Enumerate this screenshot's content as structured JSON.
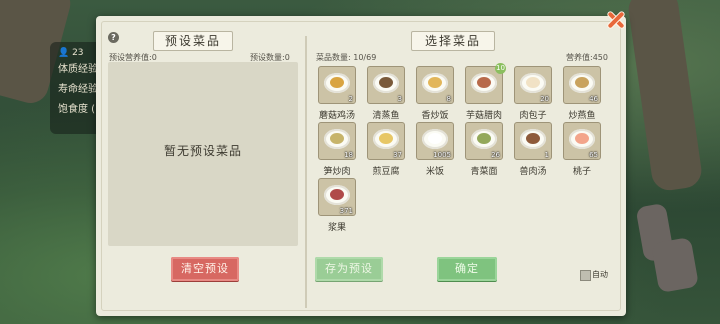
{
  "status": {
    "count": "23",
    "rows": [
      "体质经验",
      "寿命经验",
      "饱食度 ("
    ]
  },
  "left": {
    "title": "预设菜品",
    "nutrition": "预设营养值:0",
    "quantity": "预设数量:0",
    "empty": "暂无预设菜品",
    "clear_button": "清空预设"
  },
  "right": {
    "title": "选择菜品",
    "dish_count": "菜品数量: 10/69",
    "nutrition": "营养值:450",
    "save_button": "存为预设",
    "confirm_button": "确定",
    "auto_label": "自动"
  },
  "items": [
    {
      "name": "蘑菇鸡汤",
      "count": "2",
      "badge": "",
      "color": "#d9a441"
    },
    {
      "name": "清蒸鱼",
      "count": "3",
      "badge": "",
      "color": "#7a5a3a"
    },
    {
      "name": "香炒饭",
      "count": "8",
      "badge": "",
      "color": "#e2b65a"
    },
    {
      "name": "芋菇腊肉",
      "count": "",
      "badge": "10",
      "color": "#b86a4a"
    },
    {
      "name": "肉包子",
      "count": "20",
      "badge": "",
      "color": "#f1e2c5"
    },
    {
      "name": "炒燕鱼",
      "count": "46",
      "badge": "",
      "color": "#c9a35e"
    },
    {
      "name": "笋炒肉",
      "count": "18",
      "badge": "",
      "color": "#c7b46a"
    },
    {
      "name": "煎豆腐",
      "count": "37",
      "badge": "",
      "color": "#e7c766"
    },
    {
      "name": "米饭",
      "count": "1005",
      "badge": "",
      "color": "#ffffff"
    },
    {
      "name": "青菜面",
      "count": "26",
      "badge": "",
      "color": "#93a85a"
    },
    {
      "name": "兽肉汤",
      "count": "1",
      "badge": "",
      "color": "#8e5a3a"
    },
    {
      "name": "桃子",
      "count": "65",
      "badge": "",
      "color": "#f3a58b"
    },
    {
      "name": "浆果",
      "count": "371",
      "badge": "",
      "color": "#b04a4a"
    }
  ]
}
